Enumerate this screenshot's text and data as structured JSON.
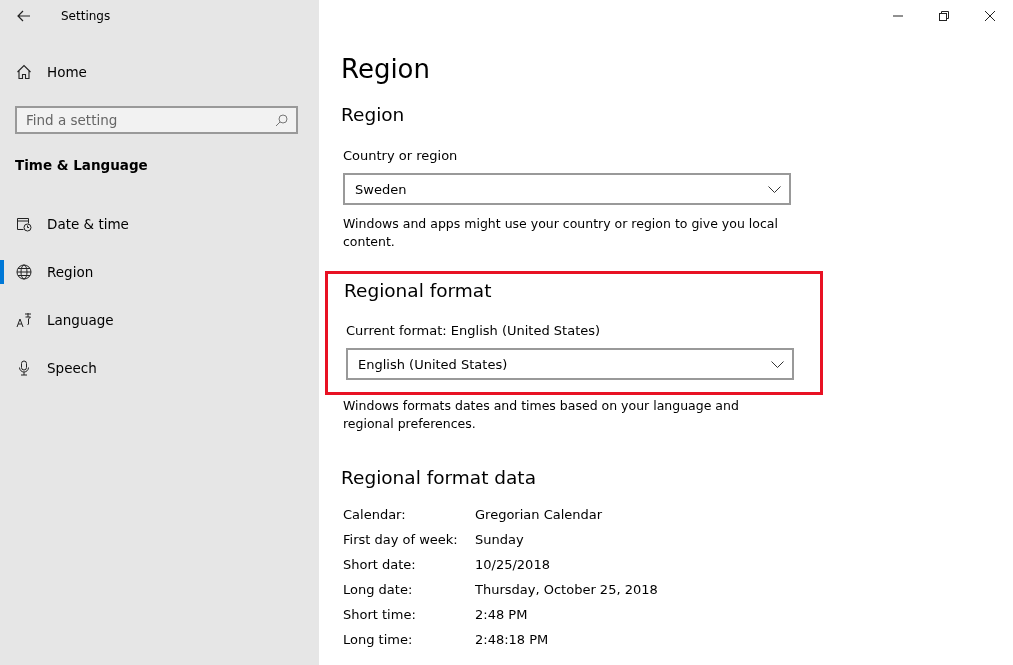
{
  "window": {
    "title": "Settings"
  },
  "sidebar": {
    "home": "Home",
    "search": {
      "placeholder": "Find a setting"
    },
    "section": "Time & Language",
    "items": [
      {
        "label": "Date & time",
        "selected": false
      },
      {
        "label": "Region",
        "selected": true
      },
      {
        "label": "Language",
        "selected": false
      },
      {
        "label": "Speech",
        "selected": false
      }
    ]
  },
  "page_title": "Region",
  "region": {
    "heading": "Region",
    "label": "Country or region",
    "value": "Sweden",
    "description": "Windows and apps might use your country or region to give you local content."
  },
  "regional_format": {
    "highlighted": true,
    "heading": "Regional format",
    "label": "Current format: English (United States)",
    "value": "English (United States)",
    "description": "Windows formats dates and times based on your language and regional preferences."
  },
  "format_data": {
    "heading": "Regional format data",
    "rows": [
      {
        "label": "Calendar:",
        "value": "Gregorian Calendar"
      },
      {
        "label": "First day of week:",
        "value": "Sunday"
      },
      {
        "label": "Short date:",
        "value": "10/25/2018"
      },
      {
        "label": "Long date:",
        "value": "Thursday, October 25, 2018"
      },
      {
        "label": "Short time:",
        "value": "2:48 PM"
      },
      {
        "label": "Long time:",
        "value": "2:48:18 PM"
      }
    ]
  }
}
